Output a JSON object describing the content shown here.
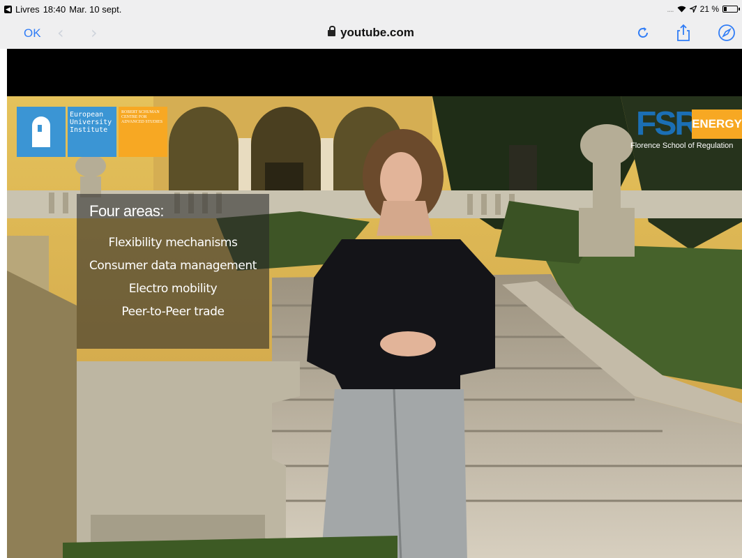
{
  "status_bar": {
    "back_app": "Livres",
    "time": "18:40",
    "date": "Mar. 10 sept.",
    "signal": "....",
    "battery_pct_text": "21 %",
    "battery_level": 0.21
  },
  "nav": {
    "done_label": "OK",
    "url": "youtube.com",
    "accent_color": "#2f7cf6"
  },
  "video": {
    "overlay_title": "Four areas:",
    "areas": [
      "Flexibility mechanisms",
      "Consumer data management",
      "Electro mobility",
      "Peer-to-Peer trade"
    ],
    "logo_eui_text": "European University Institute",
    "logo_rsc_text": "Robert Schuman Centre for Advanced Studies",
    "logo_fsr": "FSR",
    "logo_energy": "ENERGY",
    "logo_school": "Florence School of Regulation"
  }
}
